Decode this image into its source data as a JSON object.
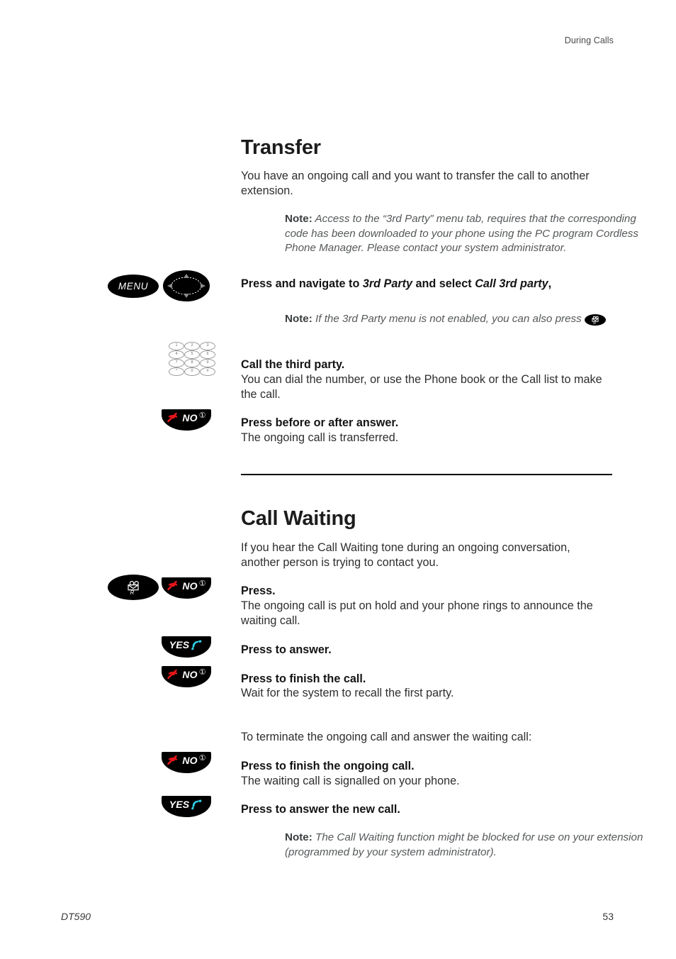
{
  "page": {
    "header": "During Calls",
    "footer_left": "DT590",
    "footer_right": "53"
  },
  "sections": [
    {
      "id": "transfer",
      "title": "Transfer",
      "intro": "You have an ongoing call and you want to transfer the call to another extension.",
      "note_label": "Note:",
      "note_text": "Access to the “3rd Party” menu tab, requires that the corresponding code has been downloaded to your phone using the PC program Cordless Phone Manager. Please contact your system administrator.",
      "steps": [
        {
          "title_pre": "Press and navigate to ",
          "title_em1": "3rd Party",
          "title_mid": " and select ",
          "title_em2": "Call 3rd party",
          "title_post": ",",
          "body": "",
          "keys": [
            "MENU",
            "navigation"
          ]
        },
        {
          "title": "Call the third party.",
          "body": "You can dial the number, or use the Phone book or the Call list to make the call.",
          "keys": [
            "keypad"
          ]
        },
        {
          "title": "Press before or after answer.",
          "body": "The ongoing call is transferred.",
          "keys": [
            "NO"
          ]
        }
      ],
      "inner_note_label": "Note:",
      "inner_note_text_pre": "If the 3rd Party menu is not enabled, you can also press ",
      "inner_note_key": "R-key"
    },
    {
      "id": "call-waiting",
      "title": "Call Waiting",
      "intro": "If you hear the Call Waiting tone during an ongoing conversation, another person is trying to contact you.",
      "steps": [
        {
          "title": "Press.",
          "body": "The ongoing call is put on hold and your phone rings to announce the waiting call.",
          "keys": [
            "R",
            "NO"
          ]
        },
        {
          "title": "Press to answer.",
          "body": "",
          "keys": [
            "YES"
          ]
        },
        {
          "title": "Press to finish the call.",
          "body": "Wait for the system to recall the first party.",
          "keys": [
            "NO"
          ]
        }
      ],
      "transition": "To terminate the ongoing call and answer the waiting call:",
      "steps2": [
        {
          "title": "Press to finish the ongoing call.",
          "body": "The waiting call is signalled on your phone.",
          "keys": [
            "NO"
          ]
        },
        {
          "title": "Press to answer the new call.",
          "body": "",
          "keys": [
            "YES"
          ]
        }
      ],
      "note_label": "Note:",
      "note_text": "The Call Waiting function might be blocked for use on your extension (programmed by your system administrator)."
    }
  ],
  "keys": {
    "menu_label": "MENU",
    "no_label": "NO",
    "yes_label": "YES",
    "r_label": "R",
    "power_symbol": "①"
  },
  "keypad": {
    "digits": [
      "1",
      "2",
      "3",
      "4",
      "5",
      "6",
      "7",
      "8",
      "9",
      "*",
      "0",
      "#"
    ]
  },
  "colors": {
    "key_body": "#000000",
    "no_handset": "#e8161a",
    "yes_handset": "#2fd2e8",
    "key_text": "#ffffff",
    "note_text": "#55585a",
    "body_text": "#2e2e2e"
  }
}
